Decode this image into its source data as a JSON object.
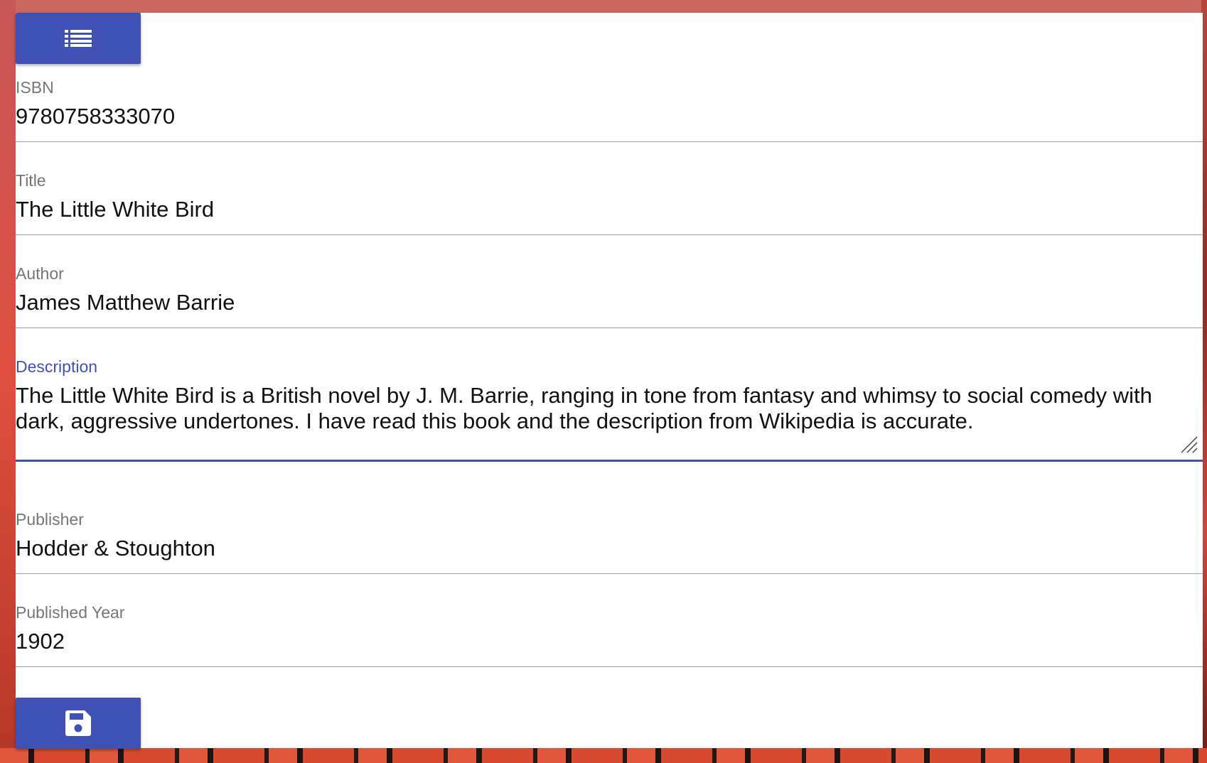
{
  "toolbar": {
    "list_icon": "list-icon",
    "save_icon": "save-icon"
  },
  "form": {
    "isbn": {
      "label": "ISBN",
      "value": "9780758333070"
    },
    "title": {
      "label": "Title",
      "value": "The Little White Bird"
    },
    "author": {
      "label": "Author",
      "value": "James Matthew Barrie"
    },
    "description": {
      "label": "Description",
      "value": "The Little White Bird is a British novel by J. M. Barrie, ranging in tone from fantasy and whimsy to social comedy with dark, aggressive undertones. I have read this book and the description from Wikipedia is accurate."
    },
    "publisher": {
      "label": "Publisher",
      "value": "Hodder & Stoughton"
    },
    "published_year": {
      "label": "Published Year",
      "value": "1902"
    }
  },
  "colors": {
    "accent": "#3f51b5",
    "label": "#757575",
    "text": "#111111",
    "divider": "#9e9e9e"
  }
}
